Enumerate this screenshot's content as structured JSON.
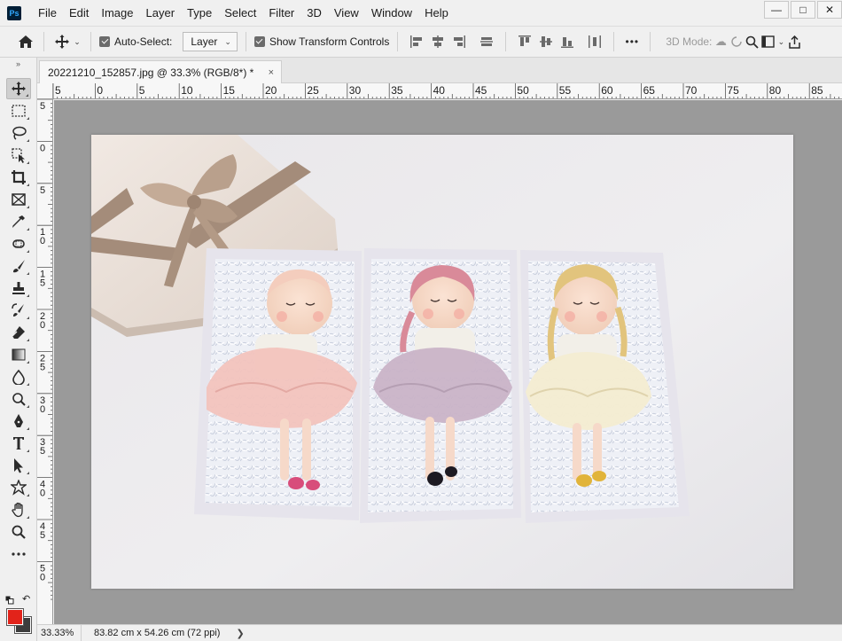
{
  "app": {
    "logo_text": "Ps",
    "menu": [
      "File",
      "Edit",
      "Image",
      "Layer",
      "Type",
      "Select",
      "Filter",
      "3D",
      "View",
      "Window",
      "Help"
    ],
    "window_controls": [
      "—",
      "□",
      "✕"
    ]
  },
  "options_bar": {
    "auto_select_label": "Auto-Select:",
    "auto_select_checked": true,
    "auto_select_target": "Layer",
    "show_transform_label": "Show Transform Controls",
    "show_transform_checked": true,
    "more_label": "•••",
    "three_d_mode_label": "3D Mode:"
  },
  "tools": [
    {
      "name": "move-tool",
      "active": true
    },
    {
      "name": "rectangular-marquee-tool"
    },
    {
      "name": "lasso-tool"
    },
    {
      "name": "object-selection-tool"
    },
    {
      "name": "crop-tool"
    },
    {
      "name": "frame-tool"
    },
    {
      "name": "eyedropper-tool"
    },
    {
      "name": "spot-healing-brush-tool"
    },
    {
      "name": "brush-tool"
    },
    {
      "name": "clone-stamp-tool"
    },
    {
      "name": "history-brush-tool"
    },
    {
      "name": "eraser-tool"
    },
    {
      "name": "gradient-tool"
    },
    {
      "name": "blur-tool"
    },
    {
      "name": "dodge-tool"
    },
    {
      "name": "pen-tool"
    },
    {
      "name": "type-tool"
    },
    {
      "name": "path-selection-tool"
    },
    {
      "name": "custom-shape-tool"
    },
    {
      "name": "hand-tool"
    },
    {
      "name": "zoom-tool"
    },
    {
      "name": "edit-toolbar"
    }
  ],
  "colors": {
    "foreground": "#e2231a",
    "background": "#3d3d3d"
  },
  "document": {
    "tab_title": "20221210_152857.jpg @ 33.3% (RGB/8*) *",
    "close_glyph": "×"
  },
  "ruler": {
    "h_labels": [
      "5",
      "0",
      "5",
      "10",
      "15",
      "20",
      "25",
      "30",
      "35",
      "40",
      "45",
      "50",
      "55",
      "60",
      "65",
      "70",
      "75",
      "80",
      "85"
    ],
    "v_labels": [
      "5",
      "0",
      "5",
      "10",
      "15",
      "20",
      "25",
      "30",
      "35",
      "40",
      "45",
      "50"
    ]
  },
  "status": {
    "zoom": "33.33%",
    "doc_size": "83.82 cm x 54.26 cm (72 ppi)",
    "arrow": "❯"
  }
}
